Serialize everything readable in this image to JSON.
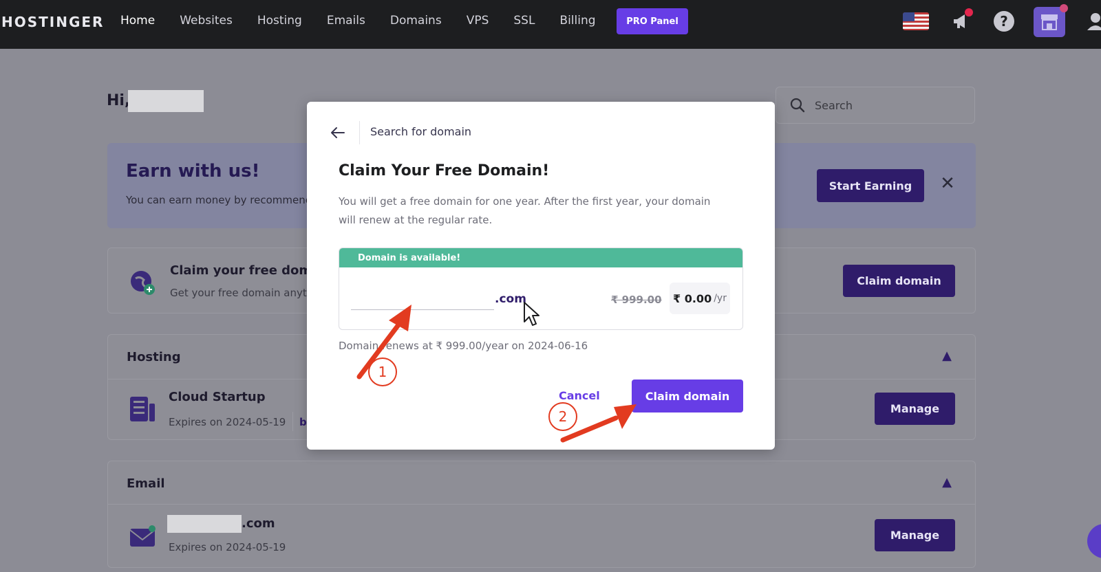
{
  "app": {
    "logo": "HOSTINGER"
  },
  "nav": {
    "items": [
      "Home",
      "Websites",
      "Hosting",
      "Emails",
      "Domains",
      "VPS",
      "SSL",
      "Billing"
    ],
    "pro_panel": "PRO Panel"
  },
  "page": {
    "greeting": "Hi,",
    "search_placeholder": "Search",
    "earn": {
      "title": "Earn with us!",
      "subtitle": "You can earn money by recommenc",
      "button": "Start Earning"
    },
    "claim": {
      "title": "Claim your free domai",
      "subtitle": "Get your free domain anyti",
      "button": "Claim domain"
    },
    "hosting": {
      "section": "Hosting",
      "plan": "Cloud Startup",
      "expires": "Expires on 2024-05-19",
      "extra": "b",
      "button": "Manage"
    },
    "email": {
      "section": "Email",
      "domain_suffix": ".com",
      "expires": "Expires on 2024-05-19",
      "button": "Manage"
    }
  },
  "modal": {
    "header": "Search for domain",
    "title": "Claim Your Free Domain!",
    "description": "You will get a free domain for one year. After the first year, your domain will renew at the regular rate.",
    "availability": "Domain is available!",
    "tld": ".com",
    "old_price": "₹ 999.00",
    "new_price": "₹ 0.00",
    "price_unit": "/yr",
    "renew_note": "Domain renews at ₹ 999.00/year on 2024-06-16",
    "cancel": "Cancel",
    "claim": "Claim domain"
  },
  "annotations": {
    "step1": "1",
    "step2": "2"
  },
  "colors": {
    "topbar": "#1d1e20",
    "primary": "#673de6",
    "available": "#4fb999",
    "annotation": "#e23b20"
  }
}
